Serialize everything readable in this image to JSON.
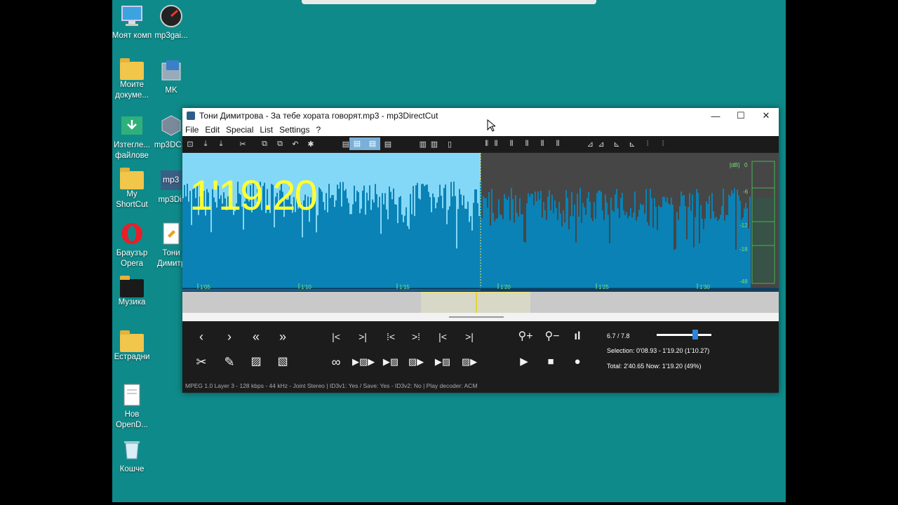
{
  "desktop": {
    "icons": [
      {
        "label": "Моят комп",
        "icon": "computer-icon"
      },
      {
        "label": "mp3gai...",
        "icon": "gauge-icon"
      },
      {
        "label": "Моите докуме...",
        "icon": "folder-icon"
      },
      {
        "label": "MK",
        "icon": "installer-icon"
      },
      {
        "label": "Изтегле... файлове",
        "icon": "download-folder-icon"
      },
      {
        "label": "mp3DC...",
        "icon": "package-icon"
      },
      {
        "label": "My ShortCut",
        "icon": "folder-icon"
      },
      {
        "label": "mp3Dir",
        "icon": "mp3-icon"
      },
      {
        "label": "Браузър Opera",
        "icon": "opera-icon"
      },
      {
        "label": "Тони Димитр",
        "icon": "file-icon"
      },
      {
        "label": "Музика",
        "icon": "folder-icon"
      },
      {
        "label": "Естрадни",
        "icon": "folder-icon"
      },
      {
        "label": "Нов OpenD...",
        "icon": "document-icon"
      },
      {
        "label": "Кошче",
        "icon": "recycle-bin-icon"
      }
    ]
  },
  "window": {
    "title": "Тони Димитрова - За тебе хората говорят.mp3 - mp3DirectCut",
    "minimize": "—",
    "maximize": "☐",
    "close": "✕",
    "menu": [
      "File",
      "Edit",
      "Special",
      "List",
      "Settings",
      "?"
    ]
  },
  "toolbar": {
    "icons": [
      "open-icon",
      "download-icon",
      "save-icon",
      "cut-icon",
      "copy-icon",
      "paste-icon",
      "undo-icon",
      "settings-icon",
      "page-icon",
      "page-icon",
      "page-icon",
      "page-icon",
      "bars-icon",
      "bars-icon",
      "pause-icon",
      "mark-icon",
      "mark-icon",
      "mark-icon",
      "mark-icon",
      "mark-icon",
      "mark-icon",
      "level-icon",
      "level-icon",
      "level-icon",
      "level-icon",
      "split-icon",
      "split-icon"
    ]
  },
  "wave": {
    "timecode": "1'19.20",
    "db_label": "[dB]",
    "db_ticks": [
      "0",
      "-6",
      "-12",
      "-18",
      "-48"
    ],
    "time_ticks": [
      "1'05",
      "1'10",
      "1'15",
      "1'20",
      "1'25",
      "1'30"
    ],
    "colors": {
      "selected_bg": "#84d8f7",
      "wave_fill": "#0a82b5",
      "unselected_bg": "#464646",
      "timecode": "#ffff33",
      "scale": "#7be07b"
    }
  },
  "controls": {
    "zoom_level": "6.7  /  7.8",
    "selection": "Selection: 0'08.93 - 1'19.20 (1'10.27)",
    "total": "Total: 2'40.65   Now: 1'19.20   (49%)",
    "zoom_slider_fraction": 0.7
  },
  "status": {
    "text": "MPEG 1.0 Layer 3  -  128 kbps  -  44 kHz  -  Joint Stereo     |     ID3v1: Yes / Save: Yes  -  ID3v2: No     |     Play decoder: ACM"
  }
}
